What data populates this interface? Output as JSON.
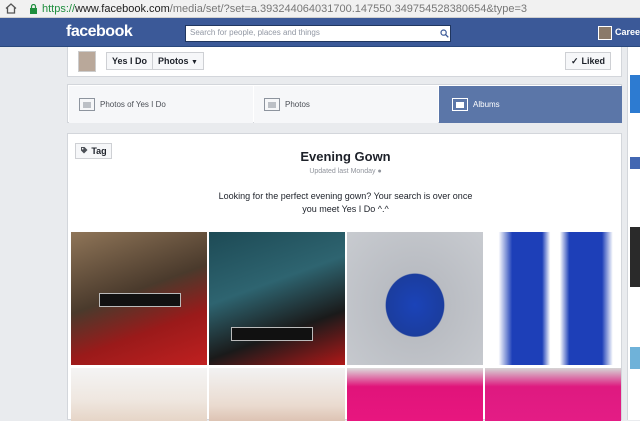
{
  "browser": {
    "url_scheme": "https://",
    "url_host": "www.facebook.com",
    "url_path": "/media/set/?set=a.393244064031700.147550.349754528380654&type=3"
  },
  "topbar": {
    "logo": "facebook",
    "search_placeholder": "Search for people, places and things",
    "user_name": "Careen"
  },
  "page_header": {
    "page_name": "Yes I Do",
    "photos_label": "Photos",
    "liked_label": "Liked"
  },
  "tabs": [
    {
      "label": "Photos of Yes I Do",
      "active": false
    },
    {
      "label": "Photos",
      "active": false
    },
    {
      "label": "Albums",
      "active": true
    }
  ],
  "album": {
    "tag_label": "Tag",
    "title": "Evening Gown",
    "updated": "Updated last Monday",
    "description": "Looking for the perfect evening gown? Your search is over once you meet Yes I Do ^.^"
  },
  "photos": [
    {
      "name": "photo-couple-red-gown"
    },
    {
      "name": "photo-couple-red-roses"
    },
    {
      "name": "photo-blue-mermaid-gown"
    },
    {
      "name": "photo-blue-gown-front-back"
    },
    {
      "name": "photo-pink-gown-model"
    },
    {
      "name": "photo-pink-gown-back"
    },
    {
      "name": "photo-pink-bodice-front"
    },
    {
      "name": "photo-pink-bodice-back"
    }
  ],
  "colors": {
    "fb_blue": "#3b5998",
    "active_tab": "#5b76a8"
  }
}
